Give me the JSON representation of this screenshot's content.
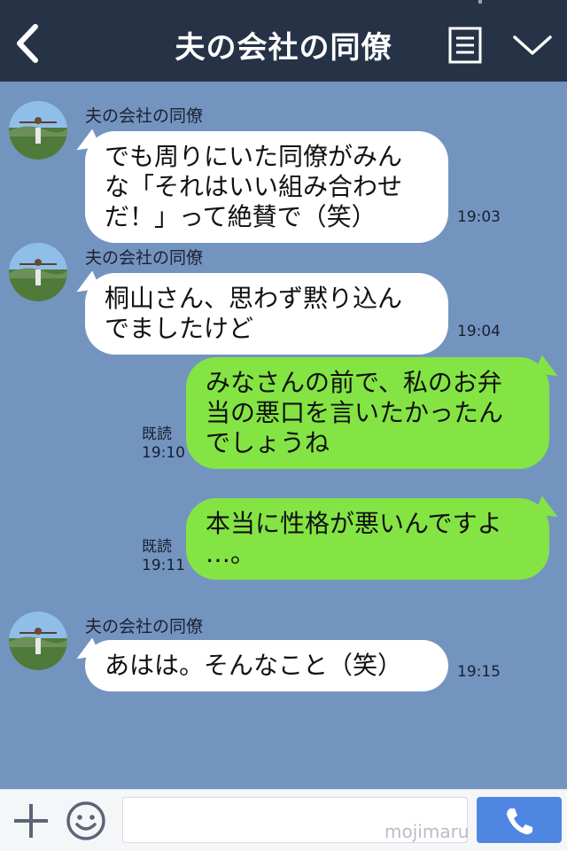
{
  "header": {
    "title": "夫の会社の同僚",
    "back_icon": "chevron-left-icon",
    "notes_icon": "notes-icon",
    "menu_icon": "chevron-down-icon"
  },
  "messages": [
    {
      "side": "left",
      "sender": "夫の会社の同僚",
      "lines": [
        "でも周りにいた同僚がみん",
        "な「それはいい組み合わせ",
        "だ！」って絶賛で（笑）"
      ],
      "time": "19:03"
    },
    {
      "side": "left",
      "sender": "夫の会社の同僚",
      "lines": [
        "桐山さん、思わず黙り込ん",
        "でましたけど"
      ],
      "time": "19:04"
    },
    {
      "side": "right",
      "read": "既読",
      "lines": [
        "みなさんの前で、私のお弁",
        "当の悪口を言いたかったん",
        "でしょうね"
      ],
      "time": "19:10"
    },
    {
      "side": "right",
      "read": "既読",
      "lines": [
        "本当に性格が悪いんですよ",
        "…。"
      ],
      "time": "19:11"
    },
    {
      "side": "left",
      "sender": "夫の会社の同僚",
      "lines": [
        "あはは。そんなこと（笑）"
      ],
      "time": "19:15"
    }
  ],
  "footer": {
    "add_icon": "plus-icon",
    "emoji_icon": "smile-icon",
    "send_icon": "phone-icon",
    "input_value": ""
  },
  "watermark": "mojimaru",
  "colors": {
    "background": "#7494c0",
    "header": "#263246",
    "own_bubble": "#84e444",
    "other_bubble": "#ffffff",
    "send_button": "#4f86e2"
  }
}
